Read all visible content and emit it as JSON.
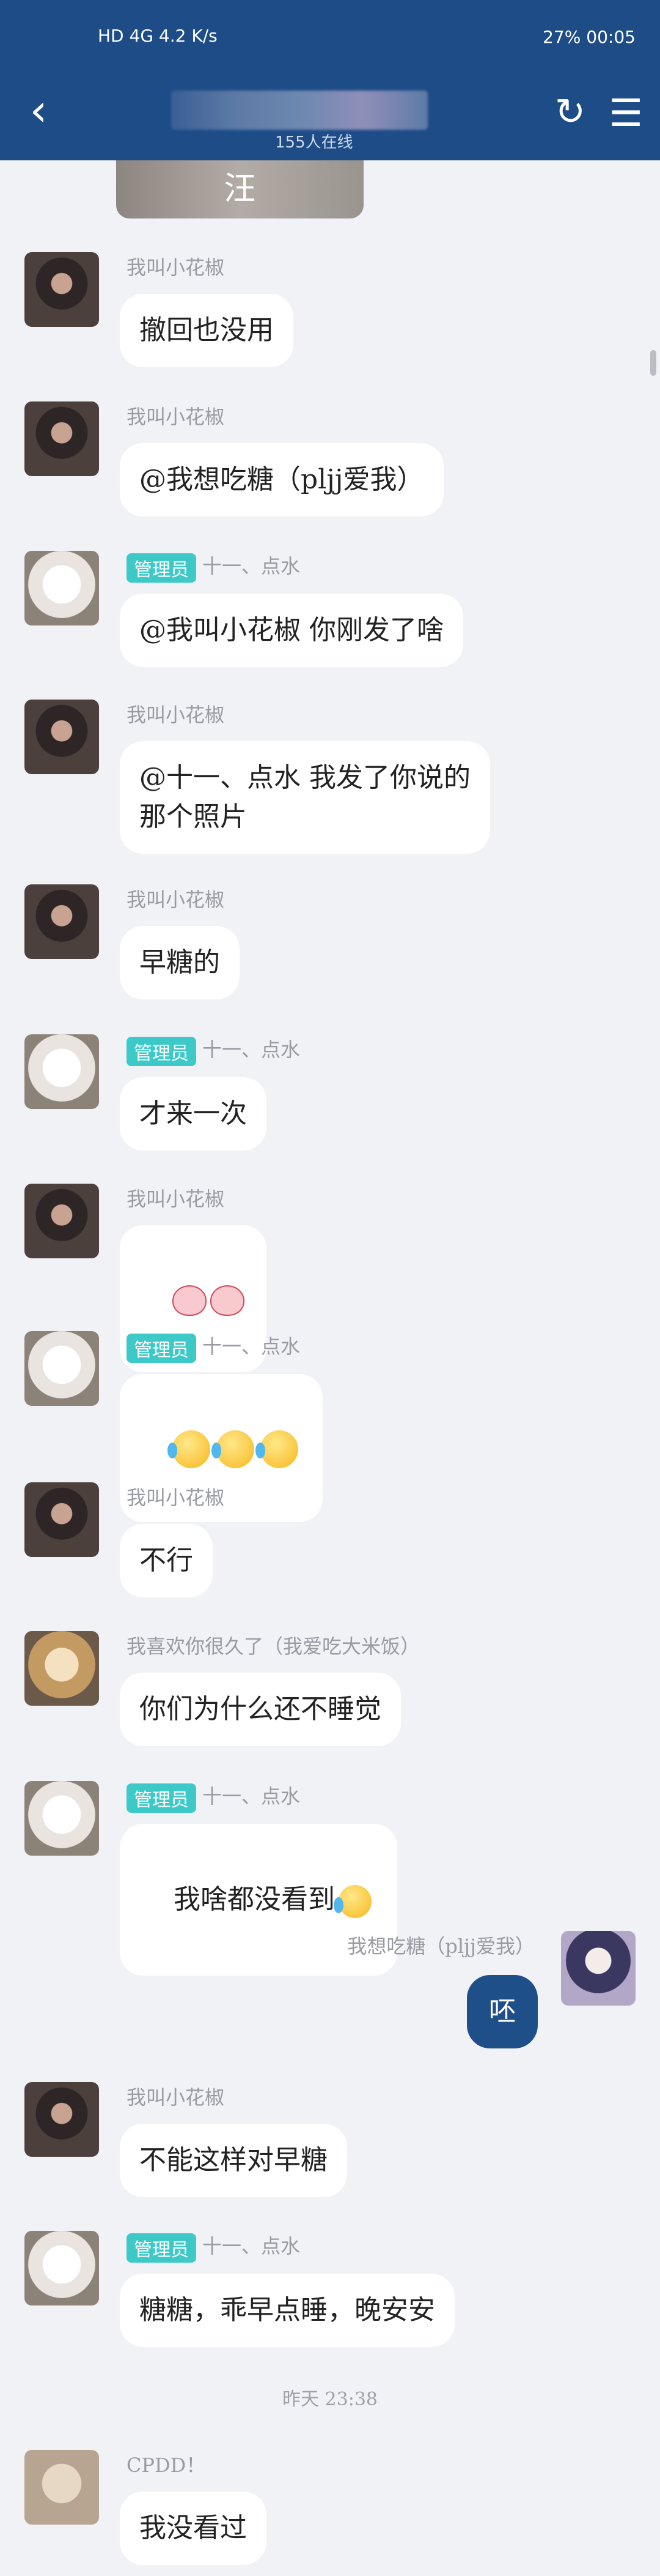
{
  "status": {
    "left": "HD 4G 4.2 K/s",
    "right": "27% 00:05"
  },
  "header": {
    "back_icon": "chevron-left-icon",
    "subtitle": "155人在线",
    "share_icon": "share-icon",
    "menu_icon": "menu-icon"
  },
  "partial_image_caption": "汪",
  "messages": [
    {
      "nick": "我叫小花椒",
      "text": "撤回也没用",
      "avatar": "girl"
    },
    {
      "nick": "我叫小花椒",
      "text": "@我想吃糖（pljj爱我）",
      "avatar": "girl"
    },
    {
      "nick": "十一、点水",
      "badge": "管理员",
      "text": "@我叫小花椒 你刚发了啥",
      "avatar": "dog"
    },
    {
      "nick": "我叫小花椒",
      "text": "@十一、点水 我发了你说的\n那个照片",
      "avatar": "girl"
    },
    {
      "nick": "我叫小花椒",
      "text": "早糖的",
      "avatar": "girl"
    },
    {
      "nick": "十一、点水",
      "badge": "管理员",
      "text": "才来一次",
      "avatar": "dog"
    },
    {
      "nick": "我叫小花椒",
      "text": "",
      "avatar": "girl"
    },
    {
      "nick": "十一、点水",
      "badge": "管理员",
      "text": "",
      "avatar": "dog"
    },
    {
      "nick": "我叫小花椒",
      "text": "不行",
      "avatar": "girl"
    },
    {
      "nick": "我喜欢你很久了（我爱吃大米饭）",
      "text": "你们为什么还不睡觉",
      "avatar": "dog2"
    },
    {
      "nick": "十一、点水",
      "badge": "管理员",
      "text": "我啥都没看到",
      "avatar": "dog"
    },
    {
      "nick": "我想吃糖（pljj爱我）",
      "text": "呸",
      "avatar": "self"
    },
    {
      "nick": "我叫小花椒",
      "text": "不能这样对早糖",
      "avatar": "girl"
    },
    {
      "nick": "十一、点水",
      "badge": "管理员",
      "text": "糖糖，乖早点睡，晚安安",
      "avatar": "dog"
    },
    {
      "nick": "CPDD！",
      "text": "我没看过",
      "avatar": "cpdd"
    }
  ],
  "timestamp": "昨天 23:38"
}
